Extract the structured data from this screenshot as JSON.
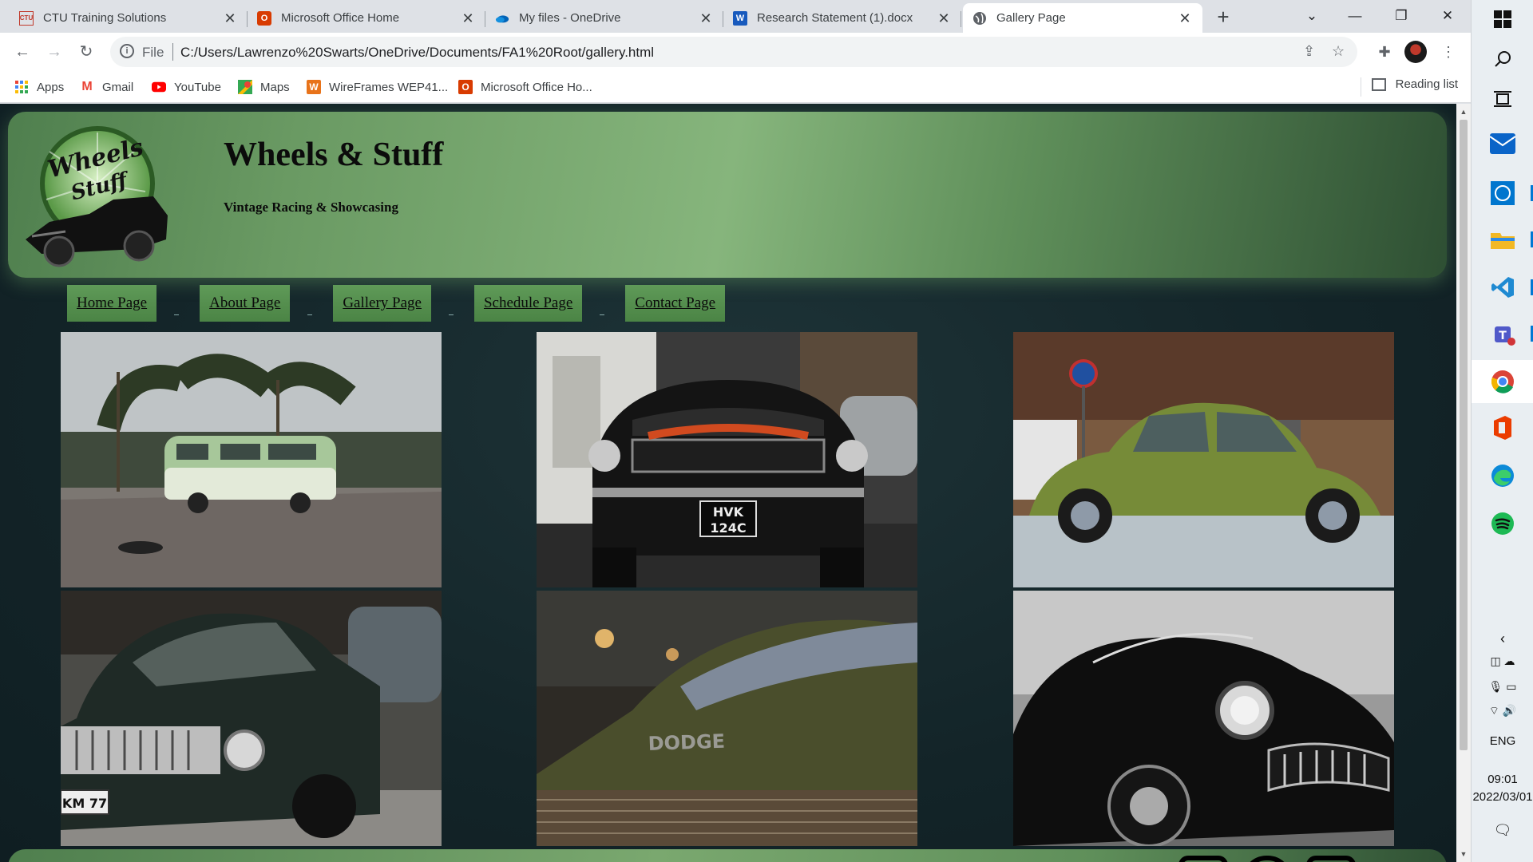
{
  "browser": {
    "tabs": [
      {
        "title": "CTU Training Solutions",
        "favicon": "ctu-favicon"
      },
      {
        "title": "Microsoft Office Home",
        "favicon": "office-favicon"
      },
      {
        "title": "My files - OneDrive",
        "favicon": "onedrive-favicon"
      },
      {
        "title": "Research Statement (1).docx",
        "favicon": "word-favicon"
      },
      {
        "title": "Gallery Page",
        "favicon": "globe-favicon",
        "active": true
      }
    ],
    "address": {
      "scheme": "File",
      "url": "C:/Users/Lawrenzo%20Swarts/OneDrive/Documents/FA1%20Root/gallery.html"
    },
    "bookmarks": [
      {
        "label": "Apps",
        "icon": "apps-grid-icon"
      },
      {
        "label": "Gmail",
        "icon": "gmail-icon"
      },
      {
        "label": "YouTube",
        "icon": "youtube-icon"
      },
      {
        "label": "Maps",
        "icon": "maps-icon"
      },
      {
        "label": "WireFrames WEP41...",
        "icon": "wireframes-icon"
      },
      {
        "label": "Microsoft Office Ho...",
        "icon": "office-icon"
      }
    ],
    "reading_list": "Reading list"
  },
  "site": {
    "title": "Wheels & Stuff",
    "subtitle": "Vintage Racing & Showcasing",
    "logo_text": "Wheels Stuff",
    "nav": [
      "Home Page",
      "About Page",
      "Gallery Page",
      "Schedule Page",
      "Contact Page"
    ],
    "gallery": [
      {
        "subject": "green-vw-van"
      },
      {
        "subject": "black-ford-mustang",
        "plate": "HVK 124C"
      },
      {
        "subject": "green-vw-beetle"
      },
      {
        "subject": "black-volga-sedan",
        "plate": "KM 77"
      },
      {
        "subject": "dodge-hood-closeup",
        "badge": "DODGE"
      },
      {
        "subject": "black-corvette"
      }
    ]
  },
  "system": {
    "language": "ENG",
    "time": "09:01",
    "date": "2022/03/01"
  },
  "colors": {
    "header_green": "#86b57c",
    "page_bg": "#132428",
    "chrome_bg": "#dee1e6"
  }
}
